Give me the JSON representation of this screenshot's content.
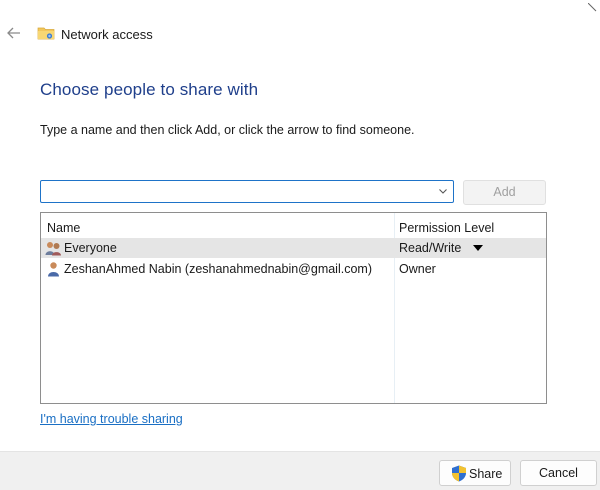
{
  "window": {
    "title": "Network access",
    "back_icon": "back-arrow-icon",
    "folder_icon": "shared-folder-icon"
  },
  "main": {
    "heading": "Choose people to share with",
    "instruction": "Type a name and then click Add, or click the arrow to find someone.",
    "name_input": {
      "value": "",
      "placeholder": ""
    },
    "add_label": "Add"
  },
  "list": {
    "columns": {
      "name": "Name",
      "permission": "Permission Level"
    },
    "rows": [
      {
        "name": "Everyone",
        "permission": "Read/Write",
        "icon": "users-group-icon",
        "selected": true
      },
      {
        "name": "ZeshanAhmed Nabin (zeshanahmednabin@gmail.com)",
        "permission": "Owner",
        "icon": "user-icon",
        "selected": false
      }
    ]
  },
  "trouble_link": "I'm having trouble sharing",
  "footer": {
    "share_label": "Share",
    "cancel_label": "Cancel",
    "share_icon": "uac-shield-icon"
  },
  "colors": {
    "heading": "#1f3f8b",
    "link": "#1a6fc4",
    "input_border": "#1e73c8",
    "selected_row": "#e5e5e5",
    "footer_bg": "#f0f0f0"
  }
}
